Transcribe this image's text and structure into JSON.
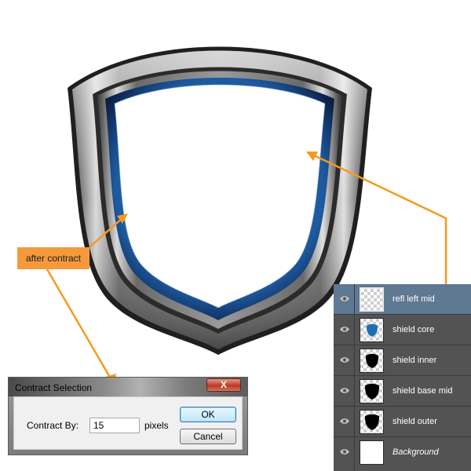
{
  "annotation": {
    "label": "after contract"
  },
  "dialog": {
    "title": "Contract Selection",
    "close_glyph": "X",
    "field_label": "Contract By:",
    "value": "15",
    "unit": "pixels",
    "ok_label": "OK",
    "cancel_label": "Cancel"
  },
  "layers": [
    {
      "name": "refl left mid",
      "selected": true,
      "thumb": "transparent",
      "icon": "eye-icon"
    },
    {
      "name": "shield core",
      "selected": false,
      "thumb": "blue-shield",
      "icon": "eye-icon"
    },
    {
      "name": "shield inner",
      "selected": false,
      "thumb": "black-shield",
      "icon": "eye-icon"
    },
    {
      "name": "shield base mid",
      "selected": false,
      "thumb": "black-shield",
      "icon": "eye-icon"
    },
    {
      "name": "shield outer",
      "selected": false,
      "thumb": "black-shield",
      "icon": "eye-icon"
    },
    {
      "name": "Background",
      "selected": false,
      "thumb": "white",
      "icon": "eye-icon"
    }
  ],
  "colors": {
    "callout": "#f59a3c",
    "arrow": "#f59a1e",
    "shield_blue": "#1d6fb5",
    "selected_layer": "#5f7993",
    "panel": "#535353"
  }
}
